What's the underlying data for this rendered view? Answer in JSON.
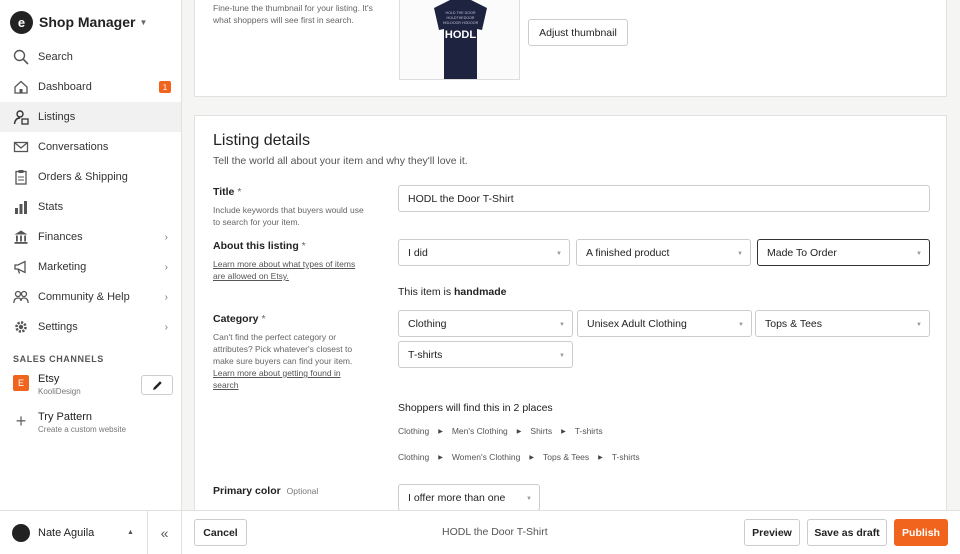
{
  "app": {
    "title": "Shop Manager"
  },
  "sidebar": {
    "items": [
      {
        "label": "Search",
        "icon": "search-icon"
      },
      {
        "label": "Dashboard",
        "icon": "home-icon",
        "badge": "1"
      },
      {
        "label": "Listings",
        "icon": "listings-icon",
        "active": true
      },
      {
        "label": "Conversations",
        "icon": "mail-icon"
      },
      {
        "label": "Orders & Shipping",
        "icon": "clipboard-icon"
      },
      {
        "label": "Stats",
        "icon": "bar-chart-icon"
      },
      {
        "label": "Finances",
        "icon": "bank-icon",
        "chevron": true
      },
      {
        "label": "Marketing",
        "icon": "megaphone-icon",
        "chevron": true
      },
      {
        "label": "Community & Help",
        "icon": "people-icon",
        "chevron": true
      },
      {
        "label": "Settings",
        "icon": "gear-icon",
        "chevron": true
      }
    ],
    "sales_channels_heading": "SALES CHANNELS",
    "channels": [
      {
        "name": "Etsy",
        "sub": "KooliDesign",
        "icon_letter": "E"
      },
      {
        "name": "Try Pattern",
        "sub": "Create a custom website"
      }
    ],
    "user": {
      "name": "Nate Aguila"
    },
    "collapse_glyph": "«"
  },
  "thumbnail": {
    "help": "Fine-tune the thumbnail for your listing. It's what shoppers will see first in search.",
    "shirt_text": "HODL",
    "adjust_button": "Adjust thumbnail"
  },
  "listing_details": {
    "title": "Listing details",
    "subtitle": "Tell the world all about your item and why they'll love it.",
    "title_field": {
      "label": "Title",
      "required": "*",
      "help": "Include keywords that buyers would use to search for your item.",
      "value": "HODL the Door T-Shirt"
    },
    "about_field": {
      "label": "About this listing",
      "required": "*",
      "help_link": "Learn more about what types of items are allowed on Etsy.",
      "who_made": "I did",
      "what_is": "A finished product",
      "when_made": "Made To Order",
      "handmade_prefix": "This item is",
      "handmade_value": "handmade"
    },
    "category_field": {
      "label": "Category",
      "required": "*",
      "help": "Can't find the perfect category or attributes? Pick whatever's closest to make sure buyers can find your item.",
      "help_link": "Learn more about getting found in search",
      "selects": [
        "Clothing",
        "Unisex Adult Clothing",
        "Tops & Tees",
        "T-shirts"
      ],
      "places_heading": "Shoppers will find this in 2 places",
      "paths": [
        [
          "Clothing",
          "Men's Clothing",
          "Shirts",
          "T-shirts"
        ],
        [
          "Clothing",
          "Women's Clothing",
          "Tops & Tees",
          "T-shirts"
        ]
      ]
    },
    "color_field": {
      "label": "Primary color",
      "optional": "Optional",
      "value": "I offer more than one"
    }
  },
  "bottom_bar": {
    "cancel": "Cancel",
    "listing_title": "HODL the Door T-Shirt",
    "preview": "Preview",
    "save_draft": "Save as draft",
    "publish": "Publish"
  },
  "colors": {
    "accent": "#f1641e",
    "text": "#222222",
    "background": "#f5f5f4"
  }
}
